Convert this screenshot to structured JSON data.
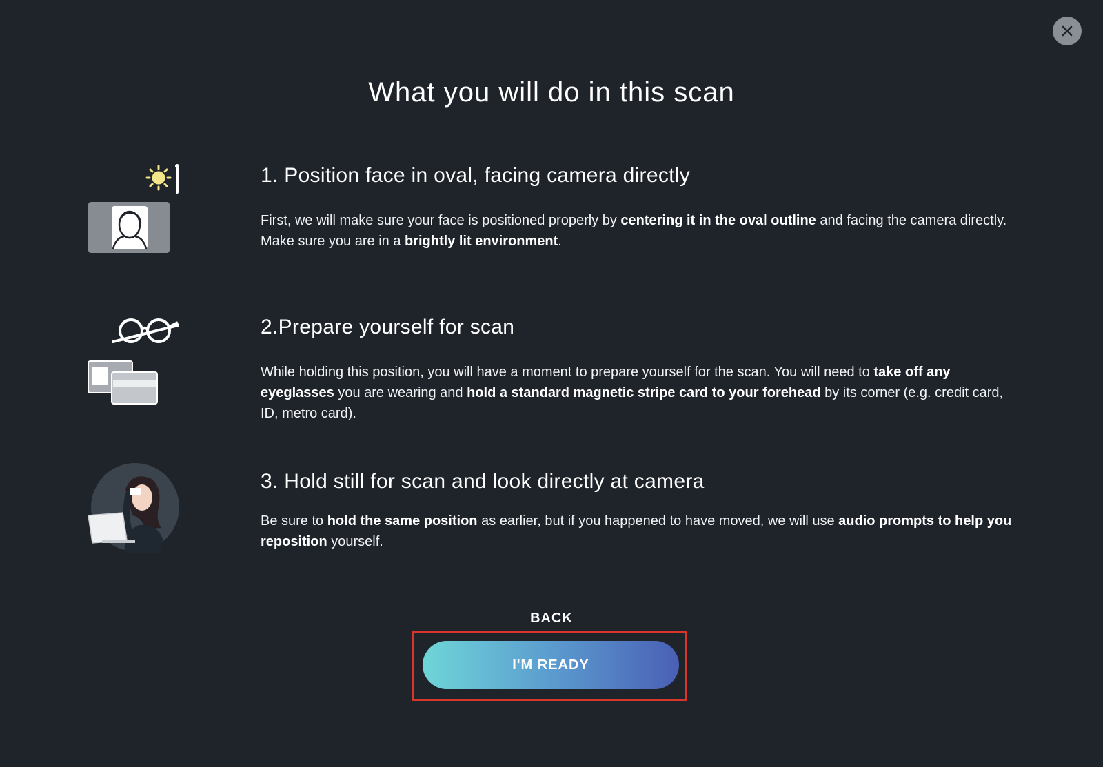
{
  "title": "What you will do in this scan",
  "close_icon": "close-icon",
  "steps": [
    {
      "icon": "face-oval-sun-icon",
      "heading": "1. Position face in oval, facing camera directly",
      "body": [
        {
          "t": "First, we will make sure your face is positioned properly by ",
          "b": false
        },
        {
          "t": "centering it in the oval outline",
          "b": true
        },
        {
          "t": " and facing the camera directly. Make sure you are in a ",
          "b": false
        },
        {
          "t": "brightly lit environment",
          "b": true
        },
        {
          "t": ".",
          "b": false
        }
      ]
    },
    {
      "icon": "no-glasses-card-icon",
      "heading": "2.Prepare yourself for scan",
      "body": [
        {
          "t": "While holding this position, you will have a moment to prepare yourself for the scan. You will need to ",
          "b": false
        },
        {
          "t": "take off any eyeglasses",
          "b": true
        },
        {
          "t": " you are wearing and ",
          "b": false
        },
        {
          "t": "hold a standard magnetic stripe card to your forehead",
          "b": true
        },
        {
          "t": " by its corner (e.g. credit card, ID, metro card).",
          "b": false
        }
      ]
    },
    {
      "icon": "person-holding-card-icon",
      "heading": "3. Hold still for scan and look directly at camera",
      "body": [
        {
          "t": "Be sure to ",
          "b": false
        },
        {
          "t": "hold the same position",
          "b": true
        },
        {
          "t": " as earlier, but if you happened to have moved, we will use ",
          "b": false
        },
        {
          "t": "audio prompts to help you reposition",
          "b": true
        },
        {
          "t": " yourself.",
          "b": false
        }
      ]
    }
  ],
  "back_label": "BACK",
  "ready_label": "I'M READY",
  "colors": {
    "background": "#1f242b",
    "highlight": "#d8362a",
    "button_gradient_start": "#6fd6d8",
    "button_gradient_end": "#4a5fb5"
  }
}
